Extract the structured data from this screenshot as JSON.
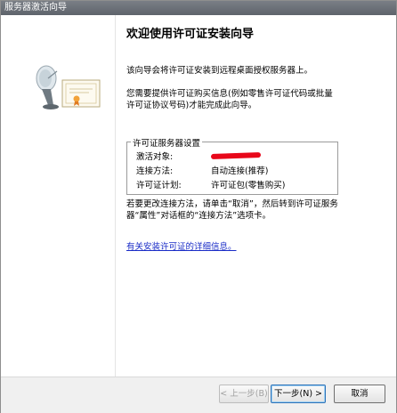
{
  "window": {
    "title": "服务器激活向导"
  },
  "heading": "欢迎使用许可证安装向导",
  "intro": "该向导会将许可证安装到远程桌面授权服务器上。",
  "info": "您需要提供许可证购买信息(例如零售许可证代码或批量许可证协议号码)才能完成此向导。",
  "settings": {
    "legend": "许可证服务器设置",
    "rows": [
      {
        "label": "激活对象:",
        "value": ""
      },
      {
        "label": "连接方法:",
        "value": "自动连接(推荐)"
      },
      {
        "label": "许可证计划:",
        "value": "许可证包(零售购买)"
      }
    ]
  },
  "note": "若要更改连接方法，请单击“取消”，然后转到许可证服务器“属性”对话框的“连接方法”选项卡。",
  "link": "有关安装许可证的详细信息。",
  "buttons": {
    "back": "< 上一步(B)",
    "next": "下一步(N) >",
    "cancel": "取消"
  }
}
